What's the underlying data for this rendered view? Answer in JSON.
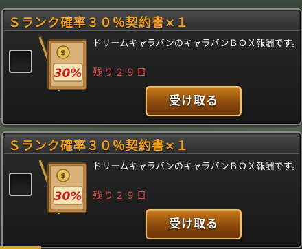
{
  "rewards": [
    {
      "title": "Ｓランク確率３０％契約書×１",
      "description": "ドリームキャラバンのキャラバンＢＯＸ報酬です。",
      "remaining": "残り２９日",
      "button_label": "受け取る",
      "icon_badge": "30%",
      "icon": "contract-scroll-icon"
    },
    {
      "title": "Ｓランク確率３０％契約書×１",
      "description": "ドリームキャラバンのキャラバンＢＯＸ報酬です。",
      "remaining": "残り２９日",
      "button_label": "受け取る",
      "icon_badge": "30%",
      "icon": "contract-scroll-icon"
    }
  ],
  "colors": {
    "title": "#f0a020",
    "remaining": "#e35050",
    "button": "#a85c12"
  }
}
